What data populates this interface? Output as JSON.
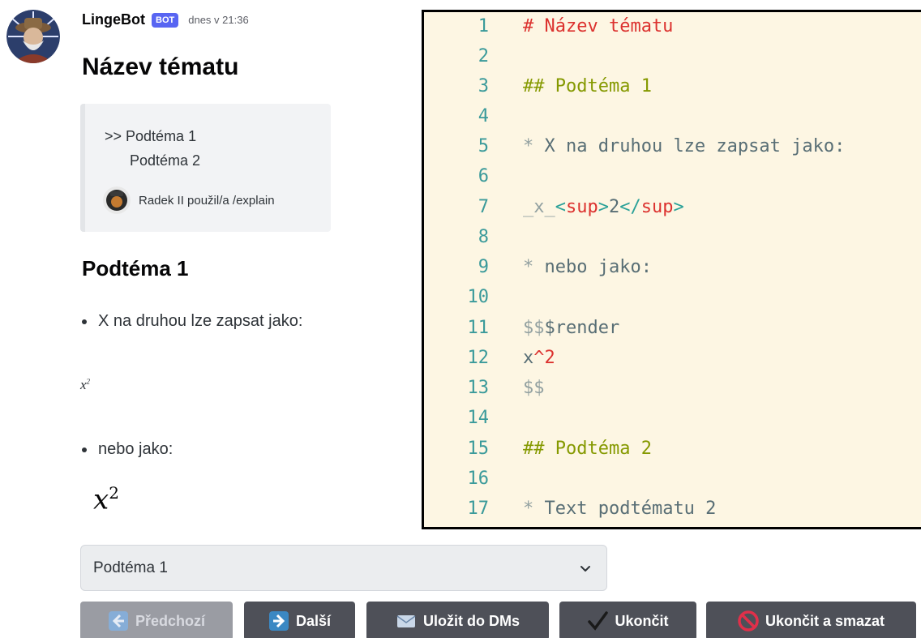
{
  "message": {
    "username": "LingeBot",
    "bot_tag": "BOT",
    "timestamp": "dnes v 21:36",
    "title": "Název tématu",
    "toc": {
      "item1": ">> Podtéma 1",
      "item2": "Podtéma 2",
      "footer": "Radek II použil/a /explain"
    },
    "section_title": "Podtéma 1",
    "bullet1": "X na druhou lze zapsat jako:",
    "x_small_base": "x",
    "x_small_exp": "2",
    "bullet2": "nebo jako:",
    "x_math_base": "x",
    "x_math_exp": "2"
  },
  "code": {
    "lines": [
      {
        "n": "1",
        "segments": [
          {
            "t": "# Název tématu",
            "c": "red"
          }
        ]
      },
      {
        "n": "2",
        "segments": []
      },
      {
        "n": "3",
        "segments": [
          {
            "t": "## Podtéma 1",
            "c": "green"
          }
        ]
      },
      {
        "n": "4",
        "segments": []
      },
      {
        "n": "5",
        "segments": [
          {
            "t": "* ",
            "c": "grey"
          },
          {
            "t": "X na druhou lze zapsat jako:",
            "c": "dark"
          }
        ]
      },
      {
        "n": "6",
        "segments": []
      },
      {
        "n": "7",
        "segments": [
          {
            "t": "_x_",
            "c": "grey"
          },
          {
            "t": "<",
            "c": "teal"
          },
          {
            "t": "sup",
            "c": "red"
          },
          {
            "t": ">",
            "c": "teal"
          },
          {
            "t": "2",
            "c": "dark"
          },
          {
            "t": "</",
            "c": "teal"
          },
          {
            "t": "sup",
            "c": "red"
          },
          {
            "t": ">",
            "c": "teal"
          }
        ]
      },
      {
        "n": "8",
        "segments": []
      },
      {
        "n": "9",
        "segments": [
          {
            "t": "* ",
            "c": "grey"
          },
          {
            "t": "nebo jako:",
            "c": "dark"
          }
        ]
      },
      {
        "n": "10",
        "segments": []
      },
      {
        "n": "11",
        "segments": [
          {
            "t": "$$",
            "c": "grey"
          },
          {
            "t": "$render",
            "c": "dark"
          }
        ]
      },
      {
        "n": "12",
        "segments": [
          {
            "t": "x",
            "c": "dark"
          },
          {
            "t": "^",
            "c": "red"
          },
          {
            "t": "2",
            "c": "red"
          }
        ]
      },
      {
        "n": "13",
        "segments": [
          {
            "t": "$$",
            "c": "grey"
          }
        ]
      },
      {
        "n": "14",
        "segments": []
      },
      {
        "n": "15",
        "segments": [
          {
            "t": "## Podtéma 2",
            "c": "green"
          }
        ]
      },
      {
        "n": "16",
        "segments": []
      },
      {
        "n": "17",
        "segments": [
          {
            "t": "* ",
            "c": "grey"
          },
          {
            "t": "Text podtématu 2",
            "c": "dark"
          }
        ]
      }
    ]
  },
  "select": {
    "value": "Podtéma 1"
  },
  "buttons": {
    "prev": "Předchozí",
    "next": "Další",
    "save": "Uložit do DMs",
    "end": "Ukončit",
    "end_delete": "Ukončit a smazat"
  },
  "icons": {
    "avatar": "bot-avatar",
    "mini_avatar": "user-avatar",
    "prev": "arrow-left-icon",
    "next": "arrow-right-icon",
    "save": "envelope-icon",
    "end": "checkmark-icon",
    "delete": "prohibited-icon",
    "dropdown": "chevron-down-icon"
  },
  "colors": {
    "blurple": "#5865f2",
    "button_grey": "#4e5058",
    "code_bg": "#fdf6e3"
  }
}
